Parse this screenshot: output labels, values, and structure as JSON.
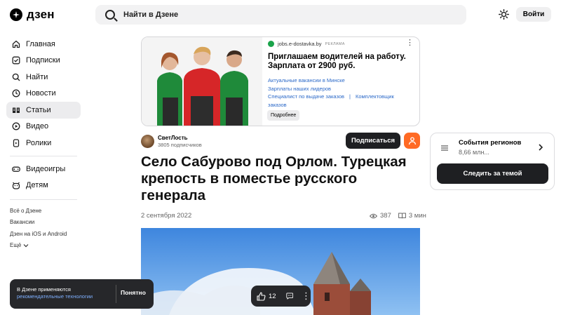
{
  "header": {
    "logo_text": "дзен",
    "search_placeholder": "Найти в Дзене",
    "login_label": "Войти"
  },
  "sidebar": {
    "items": [
      {
        "label": "Главная",
        "icon": "home-icon"
      },
      {
        "label": "Подписки",
        "icon": "subscriptions-icon"
      },
      {
        "label": "Найти",
        "icon": "search-icon"
      },
      {
        "label": "Новости",
        "icon": "news-icon"
      },
      {
        "label": "Статьи",
        "icon": "articles-icon",
        "active": true
      },
      {
        "label": "Видео",
        "icon": "video-icon"
      },
      {
        "label": "Ролики",
        "icon": "shorts-icon"
      }
    ],
    "items2": [
      {
        "label": "Видеоигры",
        "icon": "gamepad-icon"
      },
      {
        "label": "Детям",
        "icon": "kids-icon"
      }
    ],
    "footer_links": [
      "Всё о Дзене",
      "Вакансии",
      "Дзен на iOS и Android",
      "Ещё"
    ]
  },
  "ad": {
    "source": "jobs.e-dostavka.by",
    "tag": "Реклама",
    "title": "Приглашаем водителей на работу. Зарплата от 2900 руб.",
    "links": [
      "Актуальные вакансии в Минске",
      "Зарплаты наших лидеров",
      "Специалист по выдаче заказов",
      "|",
      "Комплектовщик заказов"
    ],
    "button": "Подробнее"
  },
  "article": {
    "author_name": "СветЛость",
    "author_subs": "3805 подписчиков",
    "subscribe_label": "Подписаться",
    "title": "Село Сабурово под Орлом. Турецкая крепость в поместье русского генерала",
    "date": "2 сентября 2022",
    "views": "387",
    "read_time": "3 мин"
  },
  "topic_card": {
    "title": "События регионов",
    "subtitle": "8,66 млн...",
    "button": "Следить за темой"
  },
  "cookie": {
    "text_line1": "В Дзене применяются",
    "link_text": "рекомендательные технологии",
    "button": "Понятно"
  },
  "action_bar": {
    "likes": "12"
  },
  "colors": {
    "accent_orange": "#ff6a24",
    "dark_button": "#1e1f22",
    "link_blue": "#2b69c8"
  }
}
